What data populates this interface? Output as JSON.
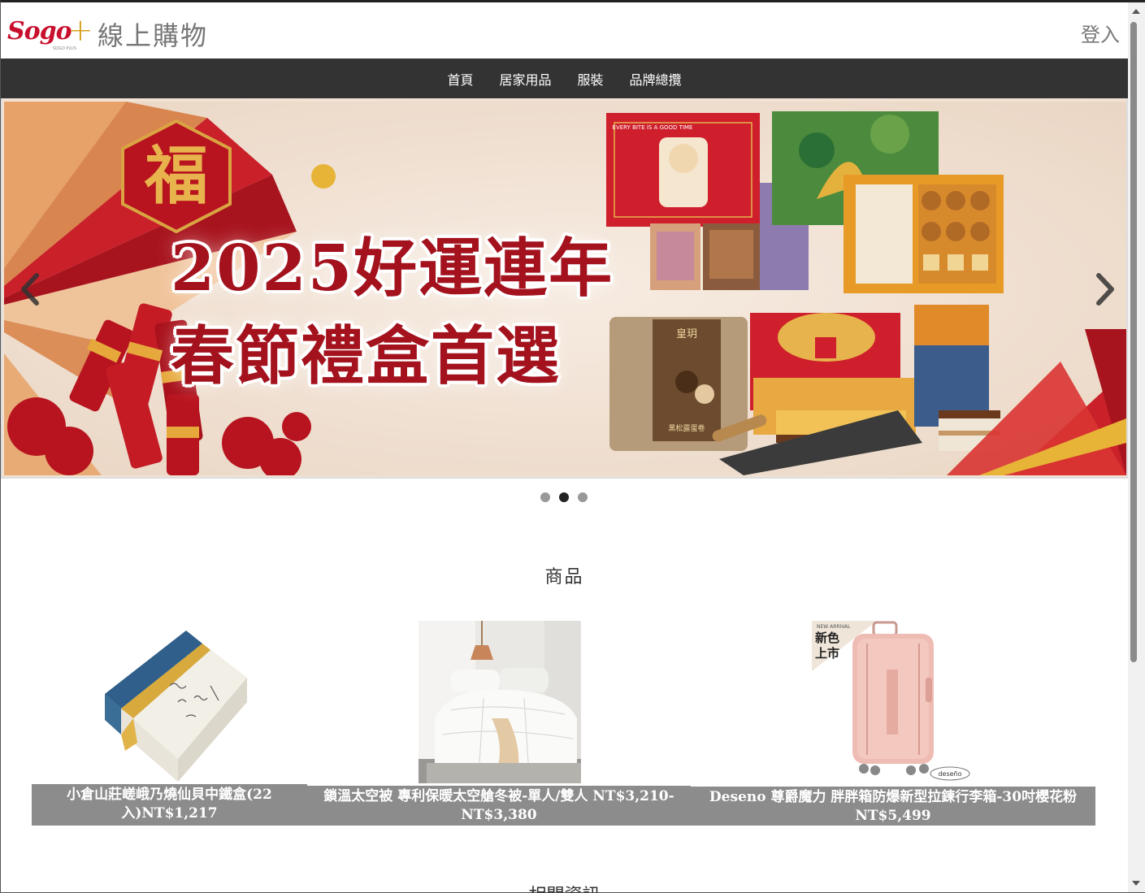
{
  "header": {
    "logo_text": "Sogo",
    "logo_sub": "SOGO PLUS",
    "site_title": "線上購物",
    "login_label": "登入"
  },
  "nav": {
    "items": [
      {
        "label": "首頁"
      },
      {
        "label": "居家用品"
      },
      {
        "label": "服裝"
      },
      {
        "label": "品牌總攬"
      }
    ]
  },
  "carousel": {
    "banner_line1": "2025好運連年",
    "banner_line2": "春節禮盒首選",
    "fu_char": "福",
    "box_text_1": "EVERY BITE IS A GOOD TIME",
    "box_text_2": "皇玥",
    "box_text_3": "黑松露蛋卷",
    "dots_count": 3,
    "active_dot": 2
  },
  "products_section": {
    "title": "商品",
    "items": [
      {
        "name": "小倉山莊嵯峨乃燒仙貝中鐵盒(22入)NT$1,217"
      },
      {
        "name": "鎖溫太空被 專利保暖太空艙冬被-單人/雙人 NT$3,210-NT$3,380"
      },
      {
        "name": "Deseno 尊爵魔力 胖胖箱防爆新型拉鍊行李箱-30吋櫻花粉 NT$5,499",
        "badge_line1": "新色",
        "badge_line2": "上市",
        "badge_small": "NEW ARRIVAL",
        "brand_mark": "deseño"
      }
    ]
  },
  "next_section": {
    "title": "相關資訊"
  },
  "colors": {
    "nav_bg": "#333333",
    "brand_red": "#c8102e",
    "caption_bg": "#8c8c8c"
  }
}
